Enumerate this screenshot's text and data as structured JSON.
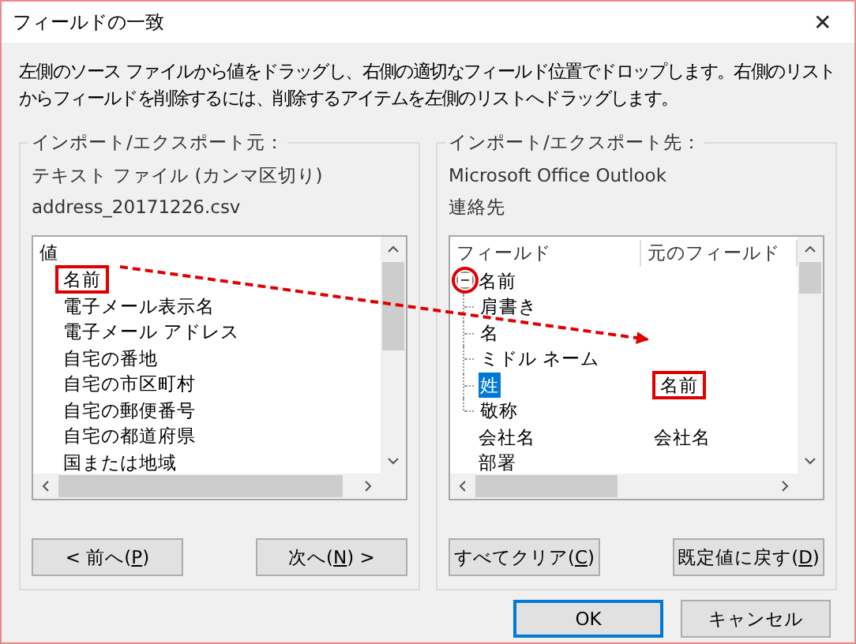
{
  "window": {
    "title": "フィールドの一致",
    "close": "✕"
  },
  "instructions": "左側のソース ファイルから値をドラッグし、右側の適切なフィールド位置でドロップします。右側のリストからフィールドを削除するには、削除するアイテムを左側のリストへドラッグします。",
  "source": {
    "caption": "インポート/エクスポート元：",
    "lines": [
      "テキスト ファイル (カンマ区切り)",
      "address_20171226.csv"
    ],
    "list": {
      "header": "値",
      "items": [
        {
          "label": "名前",
          "selected": false,
          "highlighted": true
        },
        {
          "label": "電子メール表示名",
          "selected": false,
          "highlighted": false
        },
        {
          "label": "電子メール アドレス",
          "selected": false,
          "highlighted": false
        },
        {
          "label": "自宅の番地",
          "selected": false,
          "highlighted": false
        },
        {
          "label": "自宅の市区町村",
          "selected": false,
          "highlighted": false
        },
        {
          "label": "自宅の郵便番号",
          "selected": false,
          "highlighted": false
        },
        {
          "label": "自宅の都道府県",
          "selected": false,
          "highlighted": false
        },
        {
          "label": "国または地域",
          "selected": false,
          "highlighted": false
        }
      ]
    },
    "buttons": [
      {
        "before": "< 前へ(",
        "accel": "P",
        "after": ")"
      },
      {
        "before": "次へ(",
        "accel": "N",
        "after": ") >"
      }
    ]
  },
  "target": {
    "caption": "インポート/エクスポート先：",
    "lines": [
      "Microsoft Office Outlook",
      "連絡先"
    ],
    "columns": [
      "フィールド",
      "元のフィールド"
    ],
    "rows": [
      {
        "field": "名前",
        "selected": false,
        "expanded": true,
        "circled": true,
        "children": [
          {
            "field": "肩書き",
            "selected": false
          },
          {
            "field": "名",
            "selected": false
          },
          {
            "field": "ミドル ネーム",
            "selected": false
          },
          {
            "field": "姓",
            "mapped": {
              "label": "名前",
              "highlighted": true
            },
            "selected": true
          },
          {
            "field": "敬称",
            "selected": false
          }
        ]
      },
      {
        "field": "会社名",
        "mapped": {
          "label": "会社名",
          "highlighted": false
        },
        "selected": false
      },
      {
        "field": "部署",
        "selected": false
      }
    ],
    "buttons": [
      {
        "before": "すべてクリア(",
        "accel": "C",
        "after": ")"
      },
      {
        "before": "既定値に戻す(",
        "accel": "D",
        "after": ")"
      }
    ]
  },
  "dialog_buttons": [
    {
      "label": "OK",
      "default": true
    },
    {
      "label": "キャンセル",
      "default": false
    }
  ],
  "drag_arrow": true
}
